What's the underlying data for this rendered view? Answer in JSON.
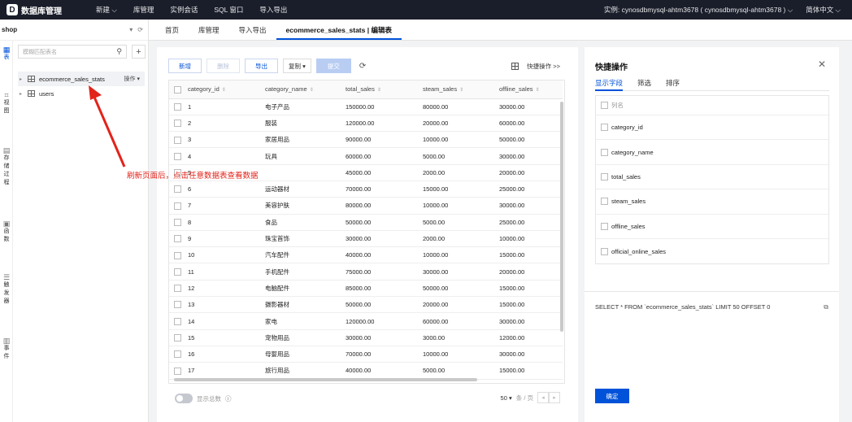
{
  "topbar": {
    "logo_glyph": "D",
    "app_title": "数据库管理",
    "nav": [
      "新建 ⌵",
      "库管理",
      "实例会话",
      "SQL 窗口",
      "导入导出"
    ],
    "instance_label": "实例: cynosdbmysql-ahtm3678 ( cynosdbmysql-ahtm3678 ) ⌵",
    "language": "简体中文 ⌵"
  },
  "sidebar": {
    "database": "shop",
    "search_placeholder": "模糊匹配表名",
    "rail": [
      {
        "icon": "table-icon",
        "label": "表"
      },
      {
        "icon": "view-icon",
        "label": "视图"
      },
      {
        "icon": "procedure-icon",
        "label": "存储过程"
      },
      {
        "icon": "function-icon",
        "label": "函数"
      },
      {
        "icon": "trigger-icon",
        "label": "触发器"
      },
      {
        "icon": "event-icon",
        "label": "事件"
      }
    ],
    "tables": [
      {
        "name": "ecommerce_sales_stats",
        "action": "操作 ▾"
      },
      {
        "name": "users",
        "action": ""
      }
    ]
  },
  "tabs": [
    "首页",
    "库管理",
    "导入导出",
    "ecommerce_sales_stats | 编辑表"
  ],
  "toolbar": {
    "add": "新增",
    "delete": "删除",
    "export": "导出",
    "copy": "复制 ▾",
    "submit": "提交",
    "quick_ops": "快捷操作 >>"
  },
  "table": {
    "columns": [
      "category_id",
      "category_name",
      "total_sales",
      "steam_sales",
      "offline_sales"
    ],
    "rows": [
      [
        "1",
        "电子产品",
        "150000.00",
        "80000.00",
        "30000.00"
      ],
      [
        "2",
        "服装",
        "120000.00",
        "20000.00",
        "60000.00"
      ],
      [
        "3",
        "家居用品",
        "90000.00",
        "10000.00",
        "50000.00"
      ],
      [
        "4",
        "玩具",
        "60000.00",
        "5000.00",
        "30000.00"
      ],
      [
        "5",
        "",
        "45000.00",
        "2000.00",
        "20000.00"
      ],
      [
        "6",
        "运动器材",
        "70000.00",
        "15000.00",
        "25000.00"
      ],
      [
        "7",
        "美容护肤",
        "80000.00",
        "10000.00",
        "30000.00"
      ],
      [
        "8",
        "食品",
        "50000.00",
        "5000.00",
        "25000.00"
      ],
      [
        "9",
        "珠宝首饰",
        "30000.00",
        "2000.00",
        "10000.00"
      ],
      [
        "10",
        "汽车配件",
        "40000.00",
        "10000.00",
        "15000.00"
      ],
      [
        "11",
        "手机配件",
        "75000.00",
        "30000.00",
        "20000.00"
      ],
      [
        "12",
        "电脑配件",
        "85000.00",
        "50000.00",
        "15000.00"
      ],
      [
        "13",
        "摄影器材",
        "50000.00",
        "20000.00",
        "15000.00"
      ],
      [
        "14",
        "家电",
        "120000.00",
        "60000.00",
        "30000.00"
      ],
      [
        "15",
        "宠物用品",
        "30000.00",
        "3000.00",
        "12000.00"
      ],
      [
        "16",
        "母婴用品",
        "70000.00",
        "10000.00",
        "30000.00"
      ],
      [
        "17",
        "旅行用品",
        "40000.00",
        "5000.00",
        "15000.00"
      ]
    ]
  },
  "footer": {
    "show_total": "显示总数",
    "page_size": "50 ▾",
    "page_suffix": "条 / 页"
  },
  "panel": {
    "title": "快捷操作",
    "tabs": [
      "显示字段",
      "筛选",
      "排序"
    ],
    "field_header": "列名",
    "fields": [
      "category_id",
      "category_name",
      "total_sales",
      "steam_sales",
      "offline_sales",
      "official_online_sales"
    ],
    "sql": "SELECT * FROM `ecommerce_sales_stats` LIMIT 50 OFFSET 0",
    "confirm": "确定"
  },
  "annotation": {
    "text": "刷新页面后，点击任意数据表查看数据",
    "color": "#e2231a"
  }
}
